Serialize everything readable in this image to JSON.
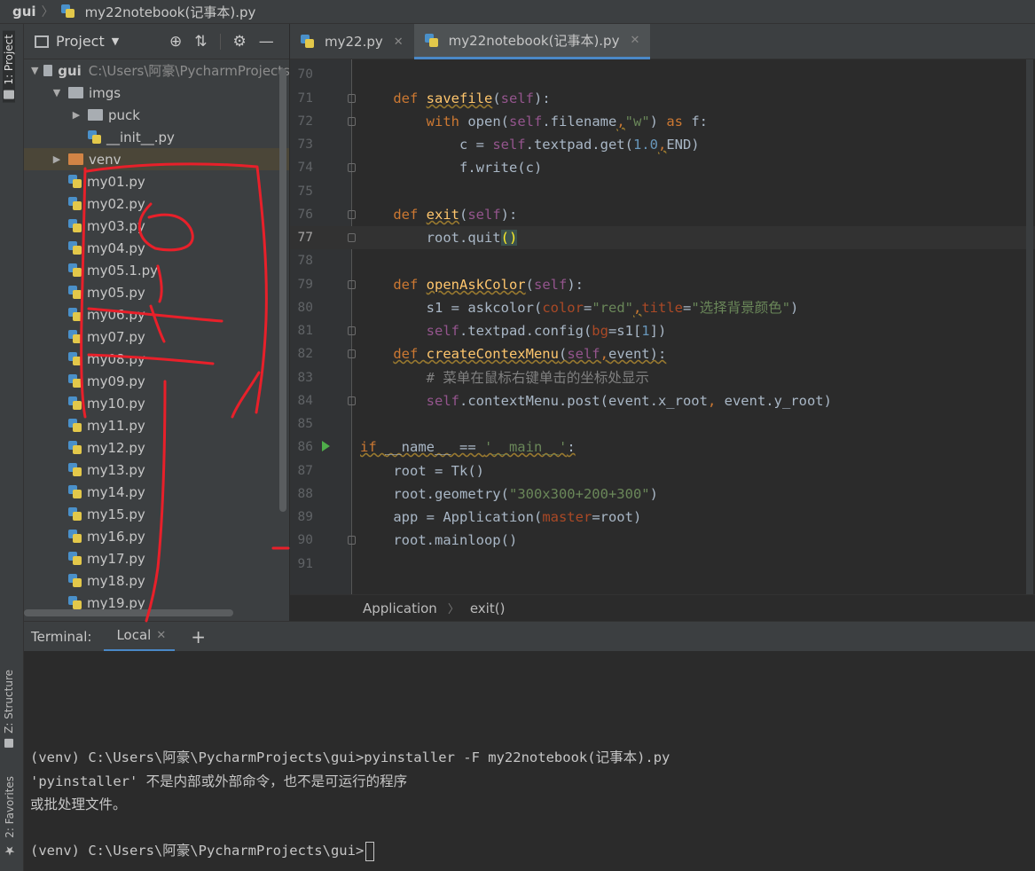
{
  "window": {
    "breadcrumb_root": "gui",
    "breadcrumb_file": "my22notebook(记事本).py"
  },
  "side_strip": {
    "project_tab": "1: Project",
    "structure_tab": "Z: Structure",
    "favorites_tab": "2: Favorites"
  },
  "project_panel": {
    "title": "Project",
    "tree": [
      {
        "label": "gui",
        "path": "C:\\Users\\阿豪\\PycharmProjects",
        "type": "folder",
        "expanded": true,
        "depth": 0
      },
      {
        "label": "imgs",
        "type": "folder",
        "expanded": true,
        "depth": 1
      },
      {
        "label": "puck",
        "type": "folder",
        "expanded": false,
        "depth": 2
      },
      {
        "label": "__init__.py",
        "type": "py",
        "depth": 2
      },
      {
        "label": "venv",
        "type": "folder-orange",
        "expanded": false,
        "depth": 1,
        "selected": true
      },
      {
        "label": "my01.py",
        "type": "py",
        "depth": 1
      },
      {
        "label": "my02.py",
        "type": "py",
        "depth": 1
      },
      {
        "label": "my03.py",
        "type": "py",
        "depth": 1
      },
      {
        "label": "my04.py",
        "type": "py",
        "depth": 1
      },
      {
        "label": "my05.1.py",
        "type": "py",
        "depth": 1
      },
      {
        "label": "my05.py",
        "type": "py",
        "depth": 1
      },
      {
        "label": "my06.py",
        "type": "py",
        "depth": 1
      },
      {
        "label": "my07.py",
        "type": "py",
        "depth": 1
      },
      {
        "label": "my08.py",
        "type": "py",
        "depth": 1
      },
      {
        "label": "my09.py",
        "type": "py",
        "depth": 1
      },
      {
        "label": "my10.py",
        "type": "py",
        "depth": 1
      },
      {
        "label": "my11.py",
        "type": "py",
        "depth": 1
      },
      {
        "label": "my12.py",
        "type": "py",
        "depth": 1
      },
      {
        "label": "my13.py",
        "type": "py",
        "depth": 1
      },
      {
        "label": "my14.py",
        "type": "py",
        "depth": 1
      },
      {
        "label": "my15.py",
        "type": "py",
        "depth": 1
      },
      {
        "label": "my16.py",
        "type": "py",
        "depth": 1
      },
      {
        "label": "my17.py",
        "type": "py",
        "depth": 1
      },
      {
        "label": "my18.py",
        "type": "py",
        "depth": 1
      },
      {
        "label": "my19.py",
        "type": "py",
        "depth": 1
      }
    ]
  },
  "editor": {
    "tabs": [
      {
        "label": "my22.py",
        "active": false
      },
      {
        "label": "my22notebook(记事本).py",
        "active": true
      }
    ],
    "breadcrumb": [
      "Application",
      "exit()"
    ],
    "current_line": "77"
  },
  "terminal": {
    "label": "Terminal:",
    "tab": "Local",
    "lines": [
      "(venv) C:\\Users\\阿豪\\PycharmProjects\\gui>pyinstaller -F my22notebook(记事本).py",
      "'pyinstaller' 不是内部或外部命令，也不是可运行的程序",
      "或批处理文件。",
      "",
      "(venv) C:\\Users\\阿豪\\PycharmProjects\\gui>"
    ]
  },
  "colors": {
    "keyword": "#cc7832",
    "function": "#ffc66d",
    "string": "#6a8759",
    "self": "#94558d",
    "number": "#6897bb",
    "comment": "#808080",
    "accent": "#4a88c7",
    "ink": "#e8202a"
  },
  "icons": {
    "project_toolbar": [
      "target-icon",
      "collapse-icon",
      "gear-icon",
      "minimize-icon"
    ]
  }
}
